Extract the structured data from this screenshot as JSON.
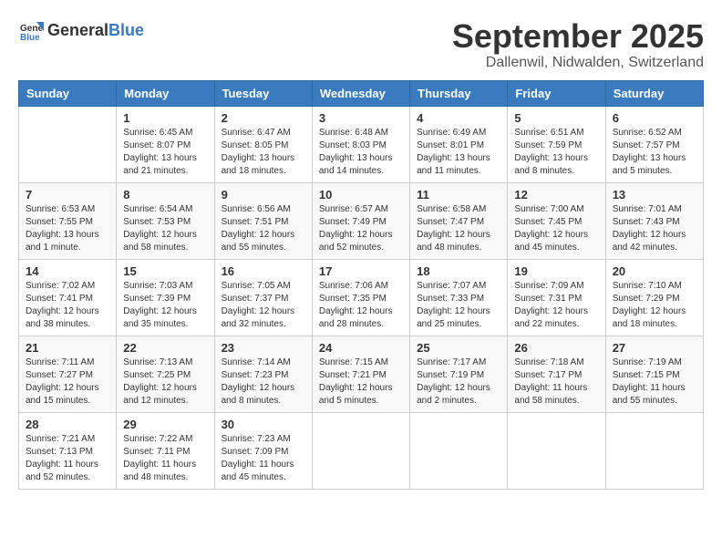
{
  "header": {
    "logo_general": "General",
    "logo_blue": "Blue",
    "month": "September 2025",
    "location": "Dallenwil, Nidwalden, Switzerland"
  },
  "days_of_week": [
    "Sunday",
    "Monday",
    "Tuesday",
    "Wednesday",
    "Thursday",
    "Friday",
    "Saturday"
  ],
  "weeks": [
    {
      "cells": [
        {
          "day": "",
          "info": ""
        },
        {
          "day": "1",
          "info": "Sunrise: 6:45 AM\nSunset: 8:07 PM\nDaylight: 13 hours\nand 21 minutes."
        },
        {
          "day": "2",
          "info": "Sunrise: 6:47 AM\nSunset: 8:05 PM\nDaylight: 13 hours\nand 18 minutes."
        },
        {
          "day": "3",
          "info": "Sunrise: 6:48 AM\nSunset: 8:03 PM\nDaylight: 13 hours\nand 14 minutes."
        },
        {
          "day": "4",
          "info": "Sunrise: 6:49 AM\nSunset: 8:01 PM\nDaylight: 13 hours\nand 11 minutes."
        },
        {
          "day": "5",
          "info": "Sunrise: 6:51 AM\nSunset: 7:59 PM\nDaylight: 13 hours\nand 8 minutes."
        },
        {
          "day": "6",
          "info": "Sunrise: 6:52 AM\nSunset: 7:57 PM\nDaylight: 13 hours\nand 5 minutes."
        }
      ]
    },
    {
      "cells": [
        {
          "day": "7",
          "info": "Sunrise: 6:53 AM\nSunset: 7:55 PM\nDaylight: 13 hours\nand 1 minute."
        },
        {
          "day": "8",
          "info": "Sunrise: 6:54 AM\nSunset: 7:53 PM\nDaylight: 12 hours\nand 58 minutes."
        },
        {
          "day": "9",
          "info": "Sunrise: 6:56 AM\nSunset: 7:51 PM\nDaylight: 12 hours\nand 55 minutes."
        },
        {
          "day": "10",
          "info": "Sunrise: 6:57 AM\nSunset: 7:49 PM\nDaylight: 12 hours\nand 52 minutes."
        },
        {
          "day": "11",
          "info": "Sunrise: 6:58 AM\nSunset: 7:47 PM\nDaylight: 12 hours\nand 48 minutes."
        },
        {
          "day": "12",
          "info": "Sunrise: 7:00 AM\nSunset: 7:45 PM\nDaylight: 12 hours\nand 45 minutes."
        },
        {
          "day": "13",
          "info": "Sunrise: 7:01 AM\nSunset: 7:43 PM\nDaylight: 12 hours\nand 42 minutes."
        }
      ]
    },
    {
      "cells": [
        {
          "day": "14",
          "info": "Sunrise: 7:02 AM\nSunset: 7:41 PM\nDaylight: 12 hours\nand 38 minutes."
        },
        {
          "day": "15",
          "info": "Sunrise: 7:03 AM\nSunset: 7:39 PM\nDaylight: 12 hours\nand 35 minutes."
        },
        {
          "day": "16",
          "info": "Sunrise: 7:05 AM\nSunset: 7:37 PM\nDaylight: 12 hours\nand 32 minutes."
        },
        {
          "day": "17",
          "info": "Sunrise: 7:06 AM\nSunset: 7:35 PM\nDaylight: 12 hours\nand 28 minutes."
        },
        {
          "day": "18",
          "info": "Sunrise: 7:07 AM\nSunset: 7:33 PM\nDaylight: 12 hours\nand 25 minutes."
        },
        {
          "day": "19",
          "info": "Sunrise: 7:09 AM\nSunset: 7:31 PM\nDaylight: 12 hours\nand 22 minutes."
        },
        {
          "day": "20",
          "info": "Sunrise: 7:10 AM\nSunset: 7:29 PM\nDaylight: 12 hours\nand 18 minutes."
        }
      ]
    },
    {
      "cells": [
        {
          "day": "21",
          "info": "Sunrise: 7:11 AM\nSunset: 7:27 PM\nDaylight: 12 hours\nand 15 minutes."
        },
        {
          "day": "22",
          "info": "Sunrise: 7:13 AM\nSunset: 7:25 PM\nDaylight: 12 hours\nand 12 minutes."
        },
        {
          "day": "23",
          "info": "Sunrise: 7:14 AM\nSunset: 7:23 PM\nDaylight: 12 hours\nand 8 minutes."
        },
        {
          "day": "24",
          "info": "Sunrise: 7:15 AM\nSunset: 7:21 PM\nDaylight: 12 hours\nand 5 minutes."
        },
        {
          "day": "25",
          "info": "Sunrise: 7:17 AM\nSunset: 7:19 PM\nDaylight: 12 hours\nand 2 minutes."
        },
        {
          "day": "26",
          "info": "Sunrise: 7:18 AM\nSunset: 7:17 PM\nDaylight: 11 hours\nand 58 minutes."
        },
        {
          "day": "27",
          "info": "Sunrise: 7:19 AM\nSunset: 7:15 PM\nDaylight: 11 hours\nand 55 minutes."
        }
      ]
    },
    {
      "cells": [
        {
          "day": "28",
          "info": "Sunrise: 7:21 AM\nSunset: 7:13 PM\nDaylight: 11 hours\nand 52 minutes."
        },
        {
          "day": "29",
          "info": "Sunrise: 7:22 AM\nSunset: 7:11 PM\nDaylight: 11 hours\nand 48 minutes."
        },
        {
          "day": "30",
          "info": "Sunrise: 7:23 AM\nSunset: 7:09 PM\nDaylight: 11 hours\nand 45 minutes."
        },
        {
          "day": "",
          "info": ""
        },
        {
          "day": "",
          "info": ""
        },
        {
          "day": "",
          "info": ""
        },
        {
          "day": "",
          "info": ""
        }
      ]
    }
  ]
}
